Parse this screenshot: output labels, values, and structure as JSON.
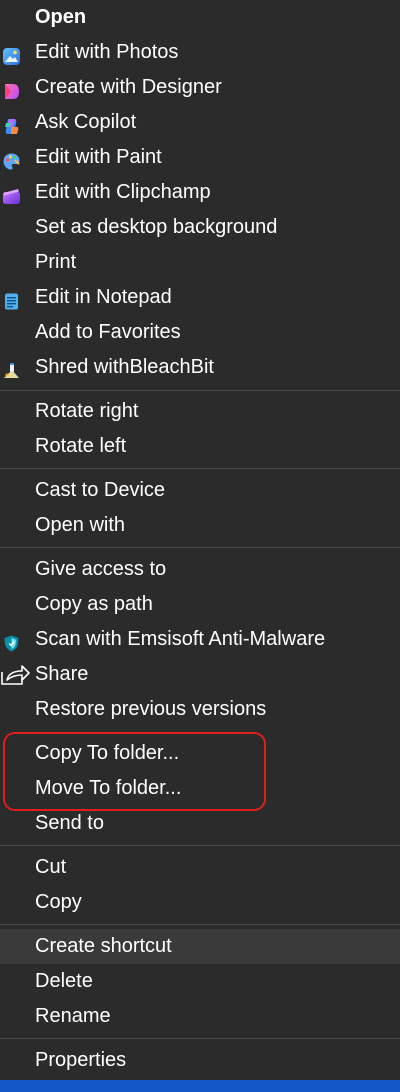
{
  "menu": {
    "groups": [
      {
        "items": [
          {
            "label": "Open",
            "icon": null
          },
          {
            "label": "Edit with Photos",
            "icon": "photos-icon"
          },
          {
            "label": "Create with Designer",
            "icon": "designer-icon"
          },
          {
            "label": "Ask Copilot",
            "icon": "copilot-icon"
          },
          {
            "label": "Edit with Paint",
            "icon": "paint-icon"
          },
          {
            "label": "Edit with Clipchamp",
            "icon": "clipchamp-icon"
          },
          {
            "label": "Set as desktop background",
            "icon": null
          },
          {
            "label": "Print",
            "icon": null
          },
          {
            "label": "Edit in Notepad",
            "icon": "notepad-icon"
          },
          {
            "label": "Add to Favorites",
            "icon": null
          },
          {
            "label": "Shred withBleachBit",
            "icon": "bleachbit-icon"
          }
        ]
      },
      {
        "items": [
          {
            "label": "Rotate right",
            "icon": null
          },
          {
            "label": "Rotate left",
            "icon": null
          }
        ]
      },
      {
        "items": [
          {
            "label": "Cast to Device",
            "icon": null
          },
          {
            "label": "Open with",
            "icon": null
          }
        ]
      },
      {
        "items": [
          {
            "label": "Give access to",
            "icon": null
          },
          {
            "label": "Copy as path",
            "icon": null
          },
          {
            "label": "Scan with Emsisoft Anti-Malware",
            "icon": "emsisoft-shield-icon"
          },
          {
            "label": "Share",
            "icon": "share-icon"
          },
          {
            "label": "Restore previous versions",
            "icon": null
          },
          {
            "label": "Copy To folder...",
            "icon": null
          },
          {
            "label": "Move To folder...",
            "icon": null
          },
          {
            "label": "Send to",
            "icon": null
          }
        ]
      },
      {
        "items": [
          {
            "label": "Cut",
            "icon": null
          },
          {
            "label": "Copy",
            "icon": null
          }
        ]
      },
      {
        "items": [
          {
            "label": "Create shortcut",
            "icon": null
          },
          {
            "label": "Delete",
            "icon": null
          },
          {
            "label": "Rename",
            "icon": null
          }
        ]
      },
      {
        "items": [
          {
            "label": "Properties",
            "icon": null
          }
        ]
      }
    ],
    "highlighted_item": "Create shortcut",
    "annotation_color": "#e01e1e"
  }
}
